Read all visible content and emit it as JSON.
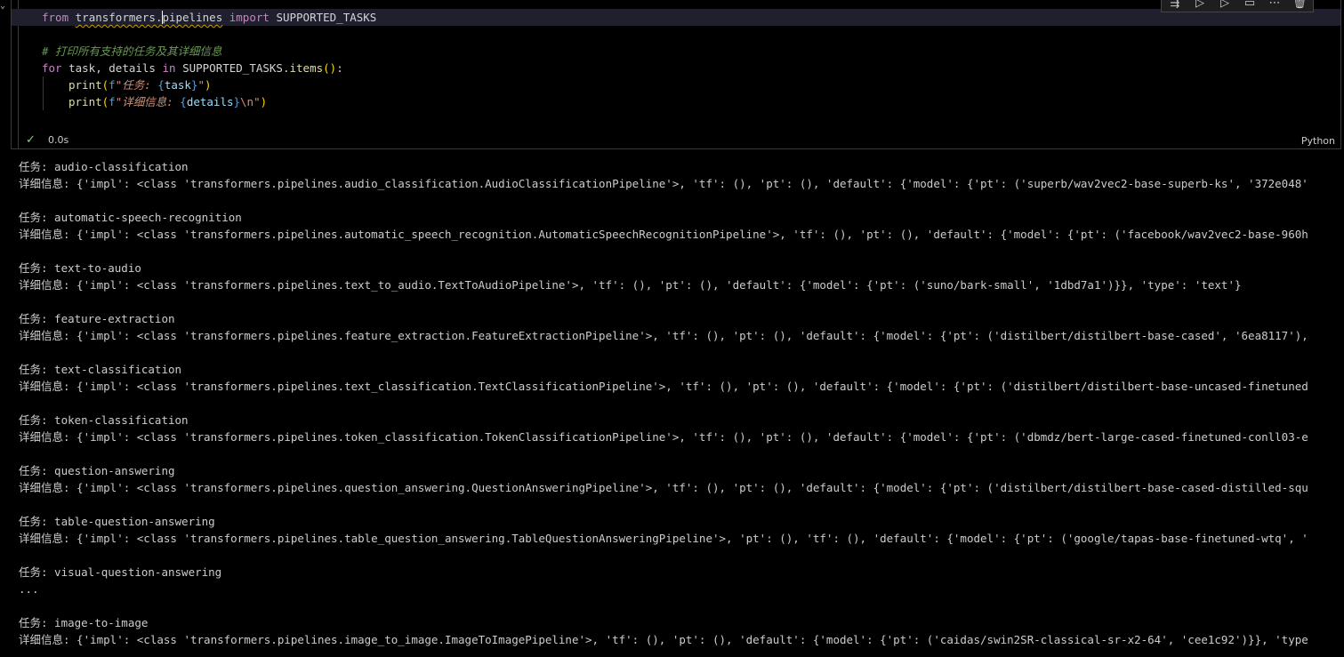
{
  "cell": {
    "code": {
      "line1": {
        "kw_from": "from",
        "module_a": "transformers.",
        "module_b": "pipelines",
        "kw_import": "import",
        "name": "SUPPORTED_TASKS"
      },
      "line2": {
        "comment": "# 打印所有支持的任务及其详细信息"
      },
      "line3": {
        "kw_for": "for",
        "vars": "task, details",
        "kw_in": "in",
        "obj": "SUPPORTED_TASKS",
        "dot": ".",
        "method": "items",
        "parens": "()",
        "colon": ":"
      },
      "line4": {
        "fn": "print",
        "open": "(",
        "fpref": "f",
        "str_a": "\"任务: ",
        "lbrace": "{",
        "var": "task",
        "rbrace": "}",
        "str_b": "\"",
        "close": ")"
      },
      "line5": {
        "fn": "print",
        "open": "(",
        "fpref": "f",
        "str_a": "\"详细信息: ",
        "lbrace": "{",
        "var": "details",
        "rbrace": "}",
        "str_b": "\\n\"",
        "close": ")"
      }
    },
    "status": {
      "check": "✓",
      "exec_time": "0.0s",
      "language": "Python"
    },
    "toolbar": [
      "run-by-line-icon",
      "execute-above-icon",
      "execute-below-icon",
      "split-cell-icon",
      "more-icon",
      "delete-icon"
    ]
  },
  "output": [
    {
      "task": "任务: audio-classification",
      "details": "详细信息: {'impl': <class 'transformers.pipelines.audio_classification.AudioClassificationPipeline'>, 'tf': (), 'pt': (), 'default': {'model': {'pt': ('superb/wav2vec2-base-superb-ks', '372e048'"
    },
    {
      "task": "任务: automatic-speech-recognition",
      "details": "详细信息: {'impl': <class 'transformers.pipelines.automatic_speech_recognition.AutomaticSpeechRecognitionPipeline'>, 'tf': (), 'pt': (), 'default': {'model': {'pt': ('facebook/wav2vec2-base-960h"
    },
    {
      "task": "任务: text-to-audio",
      "details": "详细信息: {'impl': <class 'transformers.pipelines.text_to_audio.TextToAudioPipeline'>, 'tf': (), 'pt': (), 'default': {'model': {'pt': ('suno/bark-small', '1dbd7a1')}}, 'type': 'text'}"
    },
    {
      "task": "任务: feature-extraction",
      "details": "详细信息: {'impl': <class 'transformers.pipelines.feature_extraction.FeatureExtractionPipeline'>, 'tf': (), 'pt': (), 'default': {'model': {'pt': ('distilbert/distilbert-base-cased', '6ea8117'),"
    },
    {
      "task": "任务: text-classification",
      "details": "详细信息: {'impl': <class 'transformers.pipelines.text_classification.TextClassificationPipeline'>, 'tf': (), 'pt': (), 'default': {'model': {'pt': ('distilbert/distilbert-base-uncased-finetuned"
    },
    {
      "task": "任务: token-classification",
      "details": "详细信息: {'impl': <class 'transformers.pipelines.token_classification.TokenClassificationPipeline'>, 'tf': (), 'pt': (), 'default': {'model': {'pt': ('dbmdz/bert-large-cased-finetuned-conll03-e"
    },
    {
      "task": "任务: question-answering",
      "details": "详细信息: {'impl': <class 'transformers.pipelines.question_answering.QuestionAnsweringPipeline'>, 'tf': (), 'pt': (), 'default': {'model': {'pt': ('distilbert/distilbert-base-cased-distilled-squ"
    },
    {
      "task": "任务: table-question-answering",
      "details": "详细信息: {'impl': <class 'transformers.pipelines.table_question_answering.TableQuestionAnsweringPipeline'>, 'pt': (), 'tf': (), 'default': {'model': {'pt': ('google/tapas-base-finetuned-wtq', '"
    },
    {
      "task": "任务: visual-question-answering",
      "details": "..."
    },
    {
      "task": "任务: image-to-image",
      "details": "详细信息: {'impl': <class 'transformers.pipelines.image_to_image.ImageToImagePipeline'>, 'tf': (), 'pt': (), 'default': {'model': {'pt': ('caidas/swin2SR-classical-sr-x2-64', 'cee1c92')}}, 'type"
    }
  ]
}
